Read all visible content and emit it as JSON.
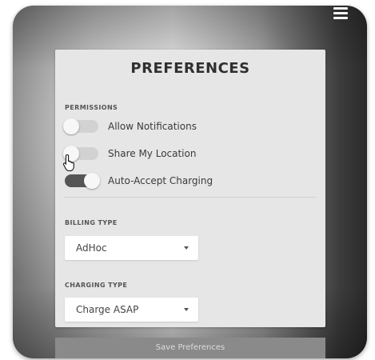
{
  "menu": {
    "icon": "hamburger-menu-icon"
  },
  "card": {
    "title": "PREFERENCES"
  },
  "permissions": {
    "label": "PERMISSIONS",
    "toggles": [
      {
        "label": "Allow Notifications",
        "on": false
      },
      {
        "label": "Share My Location",
        "on": false
      },
      {
        "label": "Auto-Accept Charging",
        "on": true
      }
    ]
  },
  "billing": {
    "label": "BILLING TYPE",
    "selected": "AdHoc"
  },
  "charging": {
    "label": "CHARGING TYPE",
    "selected": "Charge ASAP"
  },
  "save": {
    "label": "Save Preferences"
  },
  "cursor": {
    "icon": "hand-pointer-icon"
  }
}
